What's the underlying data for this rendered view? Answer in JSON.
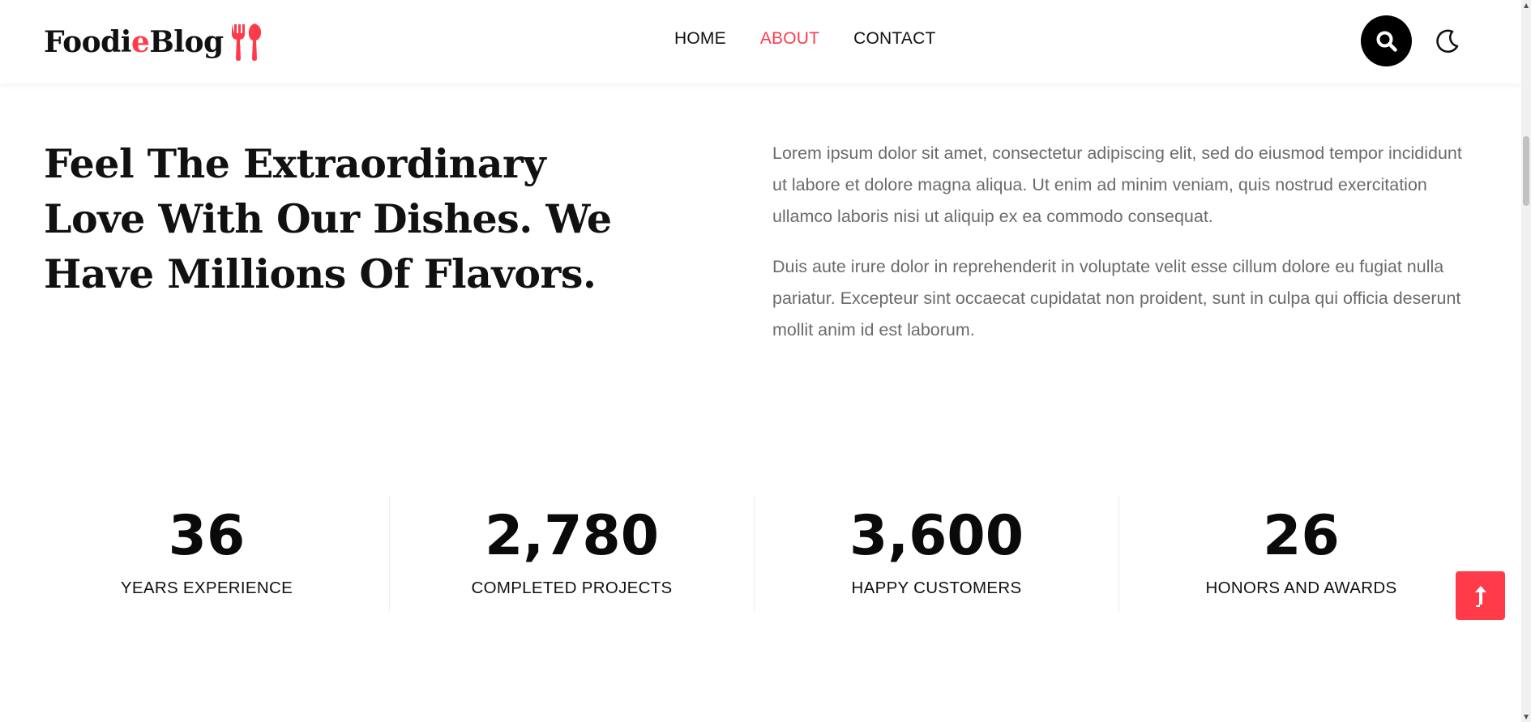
{
  "brand": {
    "name_part1": "Foodi",
    "name_accent": "e",
    "name_part2": " Blog",
    "logo_icon": "cutlery-icon",
    "accent_color": "#ff3b4a"
  },
  "nav": {
    "items": [
      {
        "label": "HOME",
        "active": false
      },
      {
        "label": "ABOUT",
        "active": true
      },
      {
        "label": "CONTACT",
        "active": false
      }
    ]
  },
  "header_actions": {
    "search_icon": "search-icon",
    "theme_icon": "moon-icon"
  },
  "about": {
    "headline": "Feel The Extraordinary Love With Our Dishes. We Have Millions Of Flavors.",
    "paragraph1": "Lorem ipsum dolor sit amet, consectetur adipiscing elit, sed do eiusmod tempor incididunt ut labore et dolore magna aliqua. Ut enim ad minim veniam, quis nostrud exercitation ullamco laboris nisi ut aliquip ex ea commodo consequat.",
    "paragraph2": "Duis aute irure dolor in reprehenderit in voluptate velit esse cillum dolore eu fugiat nulla pariatur. Excepteur sint occaecat cupidatat non proident, sunt in culpa qui officia deserunt mollit anim id est laborum."
  },
  "stats": [
    {
      "value": "36",
      "label": "YEARS EXPERIENCE"
    },
    {
      "value": "2,780",
      "label": "COMPLETED PROJECTS"
    },
    {
      "value": "3,600",
      "label": "HAPPY CUSTOMERS"
    },
    {
      "value": "26",
      "label": "HONORS AND AWARDS"
    }
  ],
  "back_to_top": {
    "icon": "arrow-up-icon",
    "color": "#ff3b4a"
  }
}
